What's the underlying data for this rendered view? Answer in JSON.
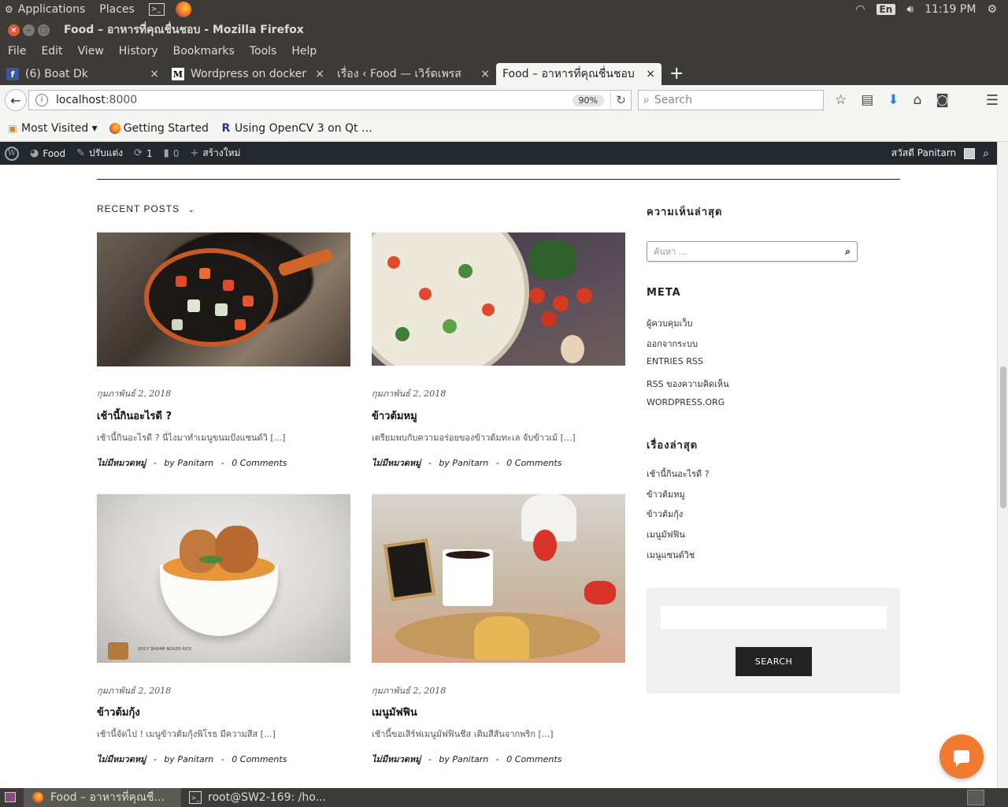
{
  "top_panel": {
    "applications": "Applications",
    "places": "Places",
    "lang": "En",
    "time": "11:19 PM"
  },
  "window": {
    "title": "Food – อาหารที่คุณชื่นชอบ - Mozilla Firefox"
  },
  "menu": [
    "File",
    "Edit",
    "View",
    "History",
    "Bookmarks",
    "Tools",
    "Help"
  ],
  "tabs": [
    {
      "label": "(6) Boat Dk",
      "icon": "facebook-icon",
      "active": false
    },
    {
      "label": "Wordpress on docker -",
      "icon": "medium-icon",
      "active": false
    },
    {
      "label": "เรื่อง ‹ Food — เวิร์ดเพรส",
      "icon": "",
      "active": false
    },
    {
      "label": "Food – อาหารที่คุณชื่นชอบ",
      "icon": "",
      "active": true
    }
  ],
  "nav": {
    "url_host": "localhost",
    "url_port": ":8000",
    "zoom": "90%",
    "search_placeholder": "Search"
  },
  "bookmarks": [
    {
      "label": "Most Visited ▾",
      "icon": "folder-icon"
    },
    {
      "label": "Getting Started",
      "icon": "firefox-icon"
    },
    {
      "label": "Using OpenCV 3 on Qt …",
      "icon": "r-icon"
    }
  ],
  "wp_bar": {
    "site": "Food",
    "customize": "ปรับแต่ง",
    "updates": "1",
    "comments": "0",
    "new": "สร้างใหม่",
    "greeting": "สวัสดี Panitarn"
  },
  "main": {
    "section_title": "RECENT POSTS",
    "posts": [
      {
        "date": "กุมภาพันธ์ 2, 2018",
        "title": "เช้านี้กินอะไรดี ?",
        "excerpt": "เช้านี้กินอะไรดี ? นี่ไงมาทำเมนูขนมปังแซนด์วิ [...]",
        "category": "ไม่มีหมวดหมู่",
        "author": "by Panitarn",
        "comments": "0 Comments"
      },
      {
        "date": "กุมภาพันธ์ 2, 2018",
        "title": "ข้าวต้มหมู",
        "excerpt": "เตรียมพบกับความอร่อยของข้าวต้มทะเล จับข้าวเม้ [...]",
        "category": "ไม่มีหมวดหมู่",
        "author": "by Panitarn",
        "comments": "0 Comments"
      },
      {
        "date": "กุมภาพันธ์ 2, 2018",
        "title": "ข้าวต้มกุ้ง",
        "excerpt": "เช้านี้จัดไป ! เมนูข้าวต้มกุ้งพิโรธ มีความสีส [...]",
        "category": "ไม่มีหมวดหมู่",
        "author": "by Panitarn",
        "comments": "0 Comments",
        "image_caption": "SPICY SHRIMP BOILED RICE"
      },
      {
        "date": "กุมภาพันธ์ 2, 2018",
        "title": "เมนูมัฟฟิน",
        "excerpt": "เช้านี้ขอเสิร์ฟเมนูมัฟฟินชีส เติมสีสันจากพริก [...]",
        "category": "ไม่มีหมวดหมู่",
        "author": "by Panitarn",
        "comments": "0 Comments"
      }
    ]
  },
  "sidebar": {
    "recent_comments_title": "ความเห็นล่าสุด",
    "search_placeholder": "ค้นหา …",
    "meta_title": "META",
    "meta_links": [
      "ผู้ควบคุมเว็บ",
      "ออกจากระบบ",
      "ENTRIES RSS",
      "RSS ของความคิดเห็น",
      "WORDPRESS.ORG"
    ],
    "recent_posts_title": "เรื่องล่าสุด",
    "recent_posts": [
      "เช้านี้กินอะไรดี ?",
      "ข้าวต้มหมู",
      "ข้าวต้มกุ้ง",
      "เมนูมัฟฟิน",
      "เมนูแซนด์วิช"
    ],
    "search_button": "SEARCH"
  },
  "taskbar": {
    "items": [
      {
        "label": "Food – อาหารที่คุณชื...",
        "icon": "firefox-icon",
        "active": true
      },
      {
        "label": "root@SW2-169: /ho...",
        "icon": "terminal-icon",
        "active": false
      }
    ]
  },
  "colors": {
    "panel": "#3c3b37",
    "wp_bar": "#23282d",
    "chat_accent": "#f07a2f",
    "search_button": "#222222"
  }
}
